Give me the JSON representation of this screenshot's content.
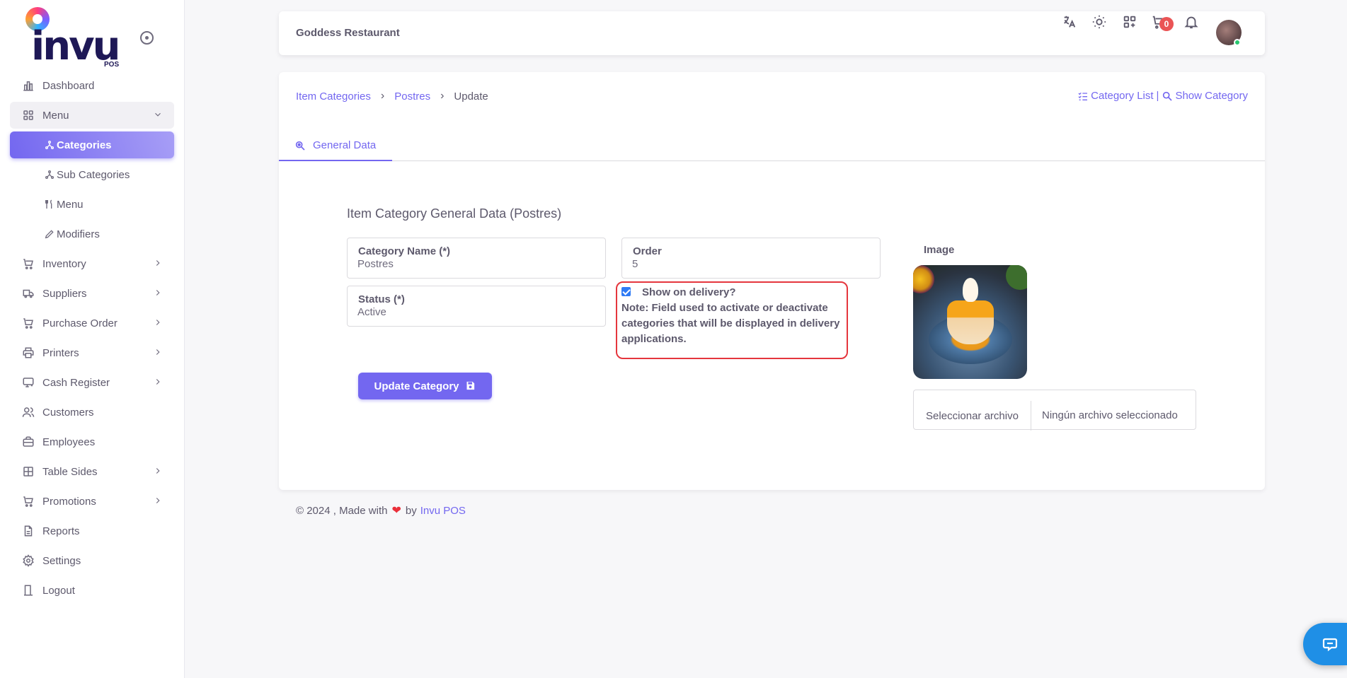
{
  "brand": {
    "logo_text": "invu",
    "logo_sub": "POS"
  },
  "sidebar": {
    "items": [
      {
        "label": "Dashboard",
        "icon": "bar-chart-icon"
      },
      {
        "label": "Menu",
        "icon": "grid-icon",
        "open": true
      },
      {
        "label": "Inventory",
        "icon": "cart-icon"
      },
      {
        "label": "Suppliers",
        "icon": "truck-icon"
      },
      {
        "label": "Purchase Order",
        "icon": "cart-icon"
      },
      {
        "label": "Printers",
        "icon": "printer-icon"
      },
      {
        "label": "Cash Register",
        "icon": "register-icon"
      },
      {
        "label": "Customers",
        "icon": "users-icon"
      },
      {
        "label": "Employees",
        "icon": "briefcase-icon"
      },
      {
        "label": "Table Sides",
        "icon": "table-icon"
      },
      {
        "label": "Promotions",
        "icon": "cart-icon"
      },
      {
        "label": "Reports",
        "icon": "file-icon"
      },
      {
        "label": "Settings",
        "icon": "gear-icon"
      },
      {
        "label": "Logout",
        "icon": "door-icon"
      }
    ],
    "submenu": [
      {
        "label": "Categories",
        "icon": "category-icon",
        "active": true
      },
      {
        "label": "Sub Categories",
        "icon": "category-icon"
      },
      {
        "label": "Menu",
        "icon": "fork-knife-icon"
      },
      {
        "label": "Modifiers",
        "icon": "pen-icon"
      }
    ]
  },
  "header": {
    "restaurant": "Goddess Restaurant",
    "cart_count": "0"
  },
  "breadcrumb": {
    "root": "Item Categories",
    "parent": "Postres",
    "current": "Update"
  },
  "actions": {
    "list": "Category List",
    "separator": "|",
    "show": "Show Category"
  },
  "tab": {
    "label": "General Data"
  },
  "form": {
    "title": "Item Category General Data (Postres)",
    "name_label": "Category Name (*)",
    "name_value": "Postres",
    "order_label": "Order",
    "order_value": "5",
    "status_label": "Status (*)",
    "status_value": "Active",
    "delivery_label": "Show on delivery?",
    "delivery_checked": true,
    "delivery_note": "Note: Field used to activate or deactivate categories that will be displayed in delivery applications.",
    "submit_label": "Update Category",
    "image_label": "Image",
    "file_button": "Seleccionar archivo",
    "file_status": "Ningún archivo seleccionado"
  },
  "footer": {
    "prefix": "© 2024 , Made with",
    "by": "by",
    "brand": "Invu POS"
  },
  "colors": {
    "primary": "#7367f0",
    "danger": "#ea5455",
    "highlight": "#e5363d",
    "chat": "#1f8fe6"
  }
}
